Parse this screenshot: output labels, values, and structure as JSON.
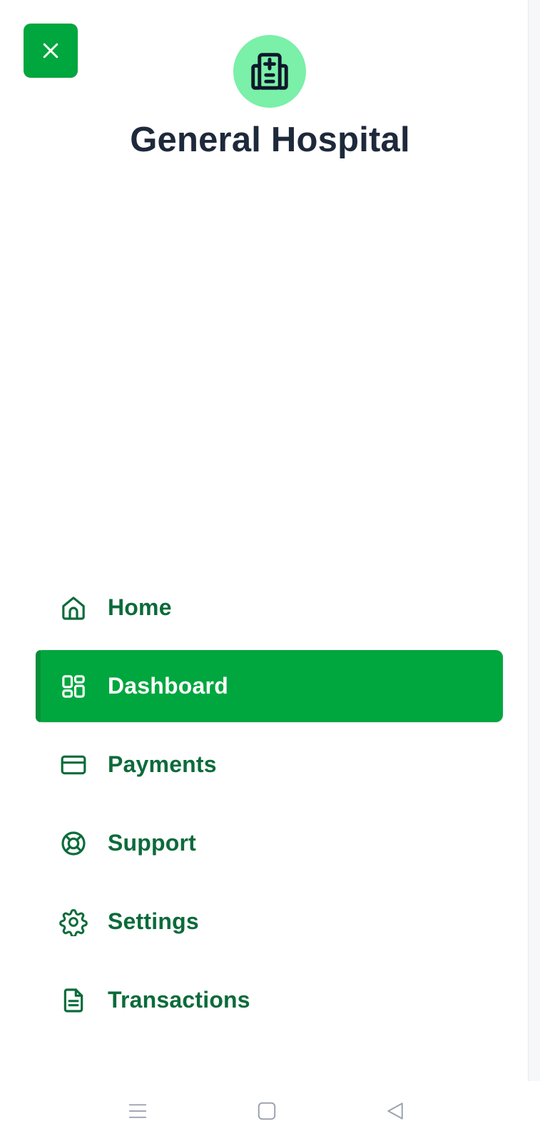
{
  "app": {
    "title": "General Hospital"
  },
  "colors": {
    "accent": "#00a63e",
    "accent_light": "#7af0a8",
    "nav_text": "#0b6b3a",
    "title_text": "#1e293b"
  },
  "header": {
    "close_icon": "close-icon",
    "logo_icon": "hospital-icon"
  },
  "nav": {
    "items": [
      {
        "label": "Home",
        "icon": "home-icon",
        "active": false
      },
      {
        "label": "Dashboard",
        "icon": "dashboard-icon",
        "active": true
      },
      {
        "label": "Payments",
        "icon": "credit-card-icon",
        "active": false
      },
      {
        "label": "Support",
        "icon": "lifebuoy-icon",
        "active": false
      },
      {
        "label": "Settings",
        "icon": "gear-icon",
        "active": false
      },
      {
        "label": "Transactions",
        "icon": "document-icon",
        "active": false
      }
    ]
  },
  "system_nav": {
    "buttons": [
      "menu-icon",
      "home-square-icon",
      "back-triangle-icon"
    ]
  }
}
